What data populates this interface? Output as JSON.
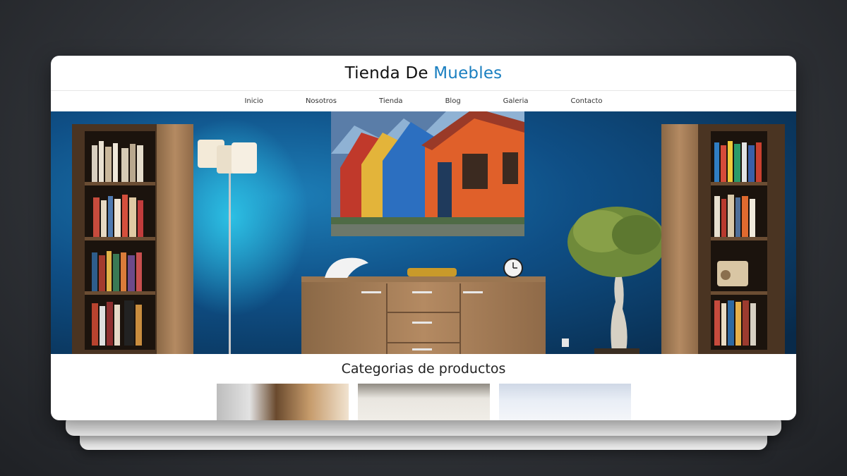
{
  "site": {
    "brand_main": "Tienda De",
    "brand_accent": "Muebles",
    "accent_color": "#1a7fc0"
  },
  "nav": {
    "items": [
      {
        "label": "Inicio"
      },
      {
        "label": "Nosotros"
      },
      {
        "label": "Tienda"
      },
      {
        "label": "Blog"
      },
      {
        "label": "Galeria"
      },
      {
        "label": "Contacto"
      }
    ]
  },
  "hero": {
    "image": "living-room-blue-wall-photo"
  },
  "categories": {
    "title": "Categorias de productos",
    "items": [
      {
        "image": "category-photo-1"
      },
      {
        "image": "category-photo-2"
      },
      {
        "image": "category-photo-3"
      }
    ]
  }
}
